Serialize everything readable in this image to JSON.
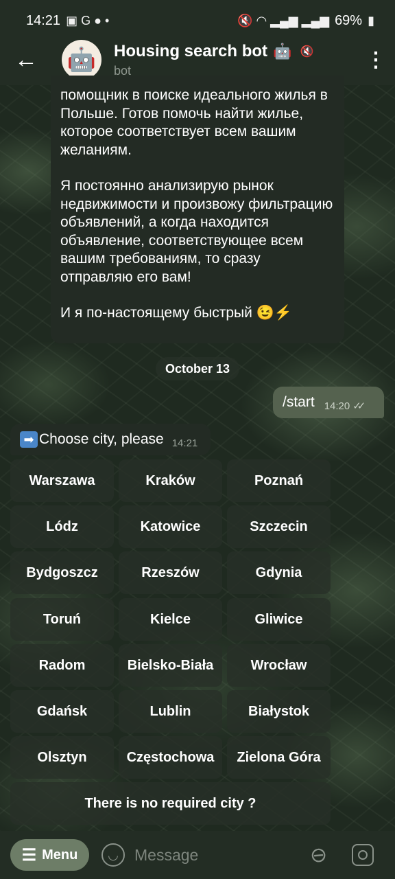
{
  "status_bar": {
    "time": "14:21",
    "left_icons": "▣ G ● •",
    "right_icons": "🔇 ◠ ▂▄▆ ▂▄▆",
    "battery": "69%"
  },
  "header": {
    "title": "Housing search bot",
    "title_emoji": "🤖",
    "subtitle": "bot",
    "avatar_glyph": "🤖"
  },
  "messages": {
    "bot_intro": [
      "помощник в поиске идеального жилья в Польше. Готов помочь найти жилье, которое соответствует всем вашим желаниям.",
      "Я постоянно анализирую рынок недвижимости и произвожу фильтрацию объявлений, а когда находится объявление, соответствующее всем вашим требованиям, то сразу отправляю его вам!",
      "И я по-настоящему быстрый 😉⚡"
    ],
    "date_separator": "October 13",
    "user_start": {
      "text": "/start",
      "time": "14:20"
    },
    "bot_choose": {
      "arrow": "➡",
      "text": "Choose city, please",
      "time": "14:21"
    }
  },
  "keyboard": {
    "rows": [
      [
        "Warszawa",
        "Kraków",
        "Poznań"
      ],
      [
        "Lódz",
        "Katowice",
        "Szczecin"
      ],
      [
        "Bydgoszcz",
        "Rzeszów",
        "Gdynia"
      ],
      [
        "Toruń",
        "Kielce",
        "Gliwice"
      ],
      [
        "Radom",
        "Bielsko-Biała",
        "Wrocław"
      ],
      [
        "Gdańsk",
        "Lublin",
        "Białystok"
      ],
      [
        "Olsztyn",
        "Częstochowa",
        "Zielona Góra"
      ]
    ],
    "no_city": "There is no required city ?"
  },
  "bottom_bar": {
    "menu_label": "Menu",
    "message_placeholder": "Message"
  }
}
